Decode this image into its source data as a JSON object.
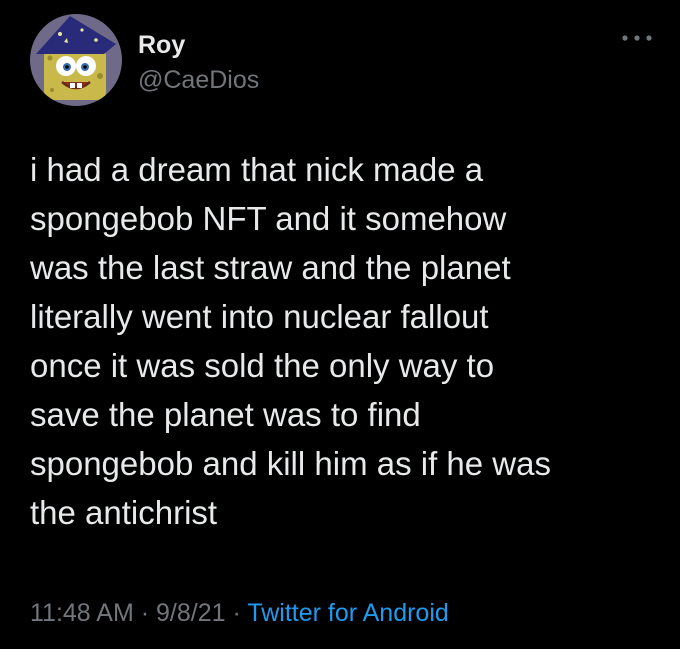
{
  "user": {
    "display_name": "Roy",
    "handle": "@CaeDios",
    "avatar": "spongebob-wizard-avatar"
  },
  "actions": {
    "more_icon": "more-horizontal-icon"
  },
  "tweet": {
    "lines": [
      "i had a dream that nick made a",
      "spongebob NFT and it somehow",
      "was the last straw and the planet",
      "literally went into nuclear fallout",
      "once it was sold the only way to",
      "save the planet was to find",
      "spongebob and kill him as if he was",
      "the antichrist"
    ]
  },
  "meta": {
    "time": "11:48 AM",
    "separator": "·",
    "date": "9/8/21",
    "source": "Twitter for Android"
  },
  "colors": {
    "background": "#000000",
    "text": "#e7e9ea",
    "secondary": "#71767b",
    "link": "#1d9bf0"
  }
}
